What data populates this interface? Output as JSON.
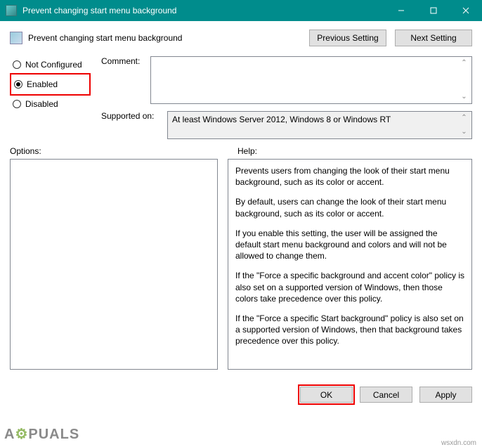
{
  "window": {
    "title": "Prevent changing start menu background"
  },
  "header": {
    "policy_title": "Prevent changing start menu background",
    "prev_btn": "Previous Setting",
    "next_btn": "Next Setting"
  },
  "state": {
    "not_configured": "Not Configured",
    "enabled": "Enabled",
    "disabled": "Disabled",
    "selected": "enabled"
  },
  "labels": {
    "comment": "Comment:",
    "supported": "Supported on:",
    "options": "Options:",
    "help": "Help:"
  },
  "comment_text": "",
  "supported_text": "At least Windows Server 2012, Windows 8 or Windows RT",
  "help_paragraphs": [
    "Prevents users from changing the look of their start menu background, such as its color or accent.",
    "By default, users can change the look of their start menu background, such as its color or accent.",
    "If you enable this setting, the user will be assigned the default start menu background and colors and will not be allowed to change them.",
    "If the \"Force a specific background and accent color\" policy is also set on a supported version of Windows, then those colors take precedence over this policy.",
    "If the \"Force a specific Start background\" policy is also set on a supported version of Windows, then that background takes precedence over this policy."
  ],
  "footer": {
    "ok": "OK",
    "cancel": "Cancel",
    "apply": "Apply"
  },
  "watermark": {
    "text_pre": "A",
    "text_mid": "⚙",
    "text_post": "PUALS",
    "url": "wsxdn.com"
  }
}
